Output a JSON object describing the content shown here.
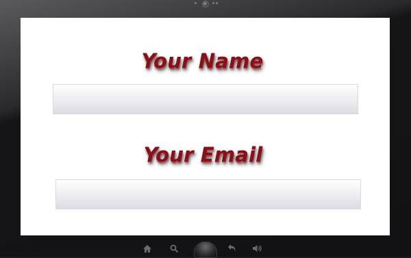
{
  "form": {
    "name_heading": "Your Name",
    "email_heading": "Your Email",
    "name_value": "",
    "email_value": ""
  },
  "nav": {
    "icons": [
      "home-icon",
      "search-icon",
      "center-button",
      "back-icon",
      "volume-icon"
    ]
  },
  "colors": {
    "heading": "#8b0f17",
    "screen": "#ffffff",
    "bezel": "#1b1b1d"
  }
}
